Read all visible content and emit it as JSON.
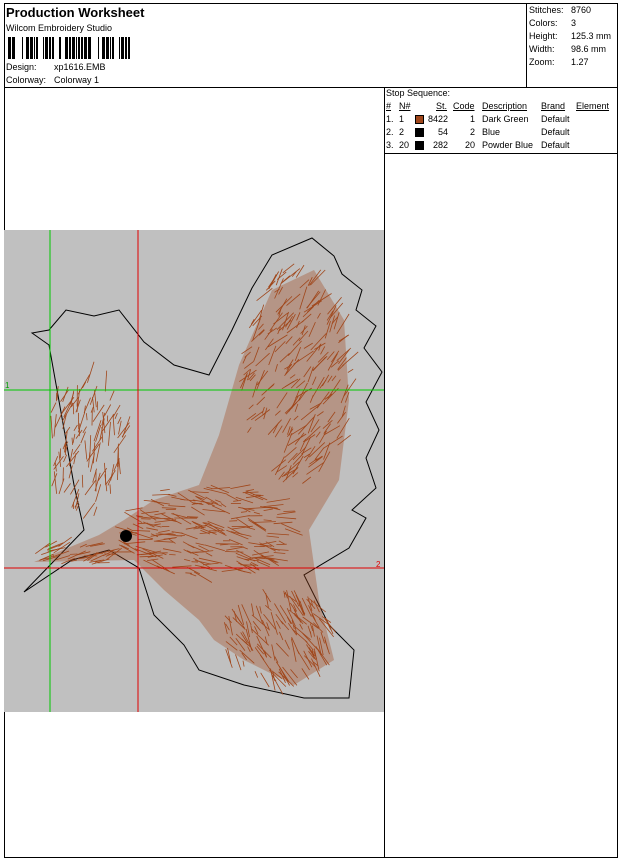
{
  "header": {
    "title": "Production Worksheet",
    "software": "Wilcom Embroidery Studio",
    "design_label": "Design:",
    "design_value": "xp1616.EMB",
    "colorway_label": "Colorway:",
    "colorway_value": "Colorway 1"
  },
  "stats": [
    {
      "label": "Stitches:",
      "value": "8760"
    },
    {
      "label": "Colors:",
      "value": "3"
    },
    {
      "label": "Height:",
      "value": "125.3 mm"
    },
    {
      "label": "Width:",
      "value": "98.6 mm"
    },
    {
      "label": "Zoom:",
      "value": "1.27"
    }
  ],
  "stop_sequence": {
    "caption": "Stop Sequence:",
    "headers": {
      "num": "#",
      "n": "N#",
      "st": "St.",
      "code": "Code",
      "desc": "Description",
      "brand": "Brand",
      "element": "Element"
    },
    "rows": [
      {
        "num": "1.",
        "n": "1",
        "color": "#a0461a",
        "st": "8422",
        "code": "1",
        "desc": "Dark Green",
        "brand": "Default"
      },
      {
        "num": "2.",
        "n": "2",
        "color": "#000000",
        "st": "54",
        "code": "2",
        "desc": "Blue",
        "brand": "Default"
      },
      {
        "num": "3.",
        "n": "20",
        "color": "#000000",
        "st": "282",
        "code": "20",
        "desc": "Powder Blue",
        "brand": "Default"
      }
    ]
  },
  "canvas": {
    "background": "#c0c0c0",
    "stitch_color": "#a0461a",
    "guide_green": "#00c800",
    "guide_red": "#e00000",
    "marker_green": "1",
    "marker_red": "2"
  }
}
